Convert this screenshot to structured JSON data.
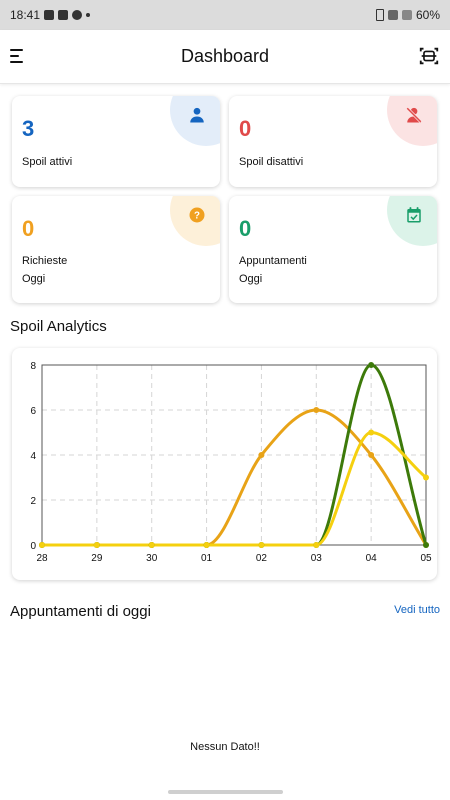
{
  "status_bar": {
    "time": "18:41",
    "battery": "60%"
  },
  "header": {
    "title": "Dashboard",
    "menu_icon": "menu-icon",
    "scan_icon": "scan-icon"
  },
  "cards": [
    {
      "value": "3",
      "label": "Spoil attivi",
      "color": "#1565c0",
      "tint": "#e3edf9",
      "icon": "person-icon"
    },
    {
      "value": "0",
      "label": "Spoil disattivi",
      "color": "#e04a4a",
      "tint": "#fbe3e3",
      "icon": "person-off-icon"
    },
    {
      "value": "0",
      "label_line1": "Richieste",
      "label_line2": "Oggi",
      "color": "#f0a020",
      "tint": "#fdf0d9",
      "icon": "help-circle-icon"
    },
    {
      "value": "0",
      "label_line1": "Appuntamenti",
      "label_line2": "Oggi",
      "color": "#1a9e6a",
      "tint": "#dcf3e9",
      "icon": "calendar-check-icon"
    }
  ],
  "analytics": {
    "title": "Spoil Analytics"
  },
  "chart_data": {
    "type": "line",
    "categories": [
      "28",
      "29",
      "30",
      "01",
      "02",
      "03",
      "04",
      "05"
    ],
    "ylim": [
      0,
      8
    ],
    "yticks": [
      "0",
      "2",
      "4",
      "6",
      "8"
    ],
    "grid": true,
    "series": [
      {
        "color": "#e8a317",
        "values": [
          0,
          0,
          0,
          0,
          4,
          6,
          4,
          0
        ]
      },
      {
        "color": "#3d7a0a",
        "values": [
          0,
          0,
          0,
          0,
          0,
          0,
          8,
          0
        ]
      },
      {
        "color": "#f5d00f",
        "values": [
          0,
          0,
          0,
          0,
          0,
          0,
          5,
          3
        ]
      }
    ]
  },
  "appointments": {
    "title": "Appuntamenti di oggi",
    "see_all": "Vedi tutto",
    "empty": "Nessun Dato!!"
  }
}
